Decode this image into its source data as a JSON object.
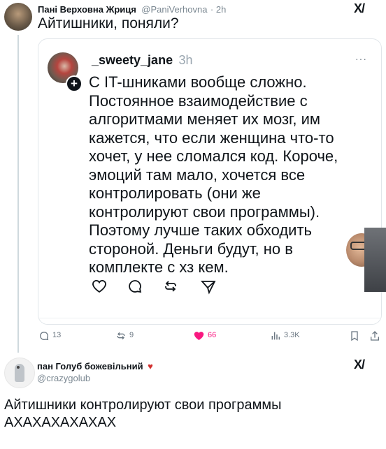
{
  "top_post": {
    "author_name": "Пані Верховна Жриця",
    "author_handle": "@PaniVerhovna",
    "time": "· 2h",
    "text": "Айтишники, поняли?"
  },
  "quoted_post": {
    "author_name": "_sweety_jane",
    "time": "3h",
    "more": "···",
    "lines": [
      "С IT-шниками вообще сложно.",
      "Постоянное взаимодействие с",
      "алгоритмами меняет их мозг, им",
      "кажется, что если женщина что-то",
      "хочет, у нее сломался код. Короче,",
      "эмоций там мало, хочется все",
      "контролировать (они же",
      "контролируют свои программы).",
      "Поэтому лучше таких обходить",
      "стороной. Деньги будут, но в",
      "комплекте с хз кем."
    ]
  },
  "metrics": {
    "replies": "13",
    "reposts": "9",
    "likes": "66",
    "views": "3.3K"
  },
  "bottom_post": {
    "author_name": "пан Голуб божевільний",
    "author_handle": "@crazygolub",
    "text_line1": "Айтишники контролируют свои программы",
    "text_line2": "АХАХАХАХАХАХ"
  },
  "brand_logo": "X/",
  "colors": {
    "like": "#f91880",
    "muted": "#6b7782",
    "border": "#e1e6ea"
  },
  "icons": [
    "reply-icon",
    "repost-icon",
    "like-icon",
    "views-icon",
    "bookmark-icon",
    "share-icon",
    "plus-badge-icon",
    "heart-icon",
    "comment-icon",
    "send-icon",
    "pigeon-emoji-icon"
  ]
}
